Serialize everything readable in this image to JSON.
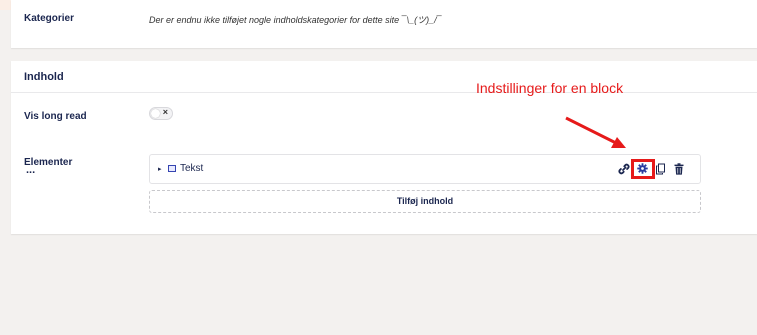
{
  "categories": {
    "label": "Kategorier",
    "description": "Der er endnu ikke tilføjet nogle indholdskategorier for dette site ¯\\_(ツ)_/¯"
  },
  "content": {
    "title": "Indhold",
    "long_read_label": "Vis long read",
    "long_read_value": "×",
    "elements_label": "Elementer",
    "elements_more": "...",
    "block": {
      "caret": "▸",
      "label": "Tekst"
    },
    "add_label": "Tilføj indhold"
  },
  "annotation": {
    "text": "Indstillinger for en block",
    "color": "#e61a1a"
  },
  "icons": [
    "link-icon",
    "gear-icon",
    "copy-icon",
    "trash-icon"
  ]
}
